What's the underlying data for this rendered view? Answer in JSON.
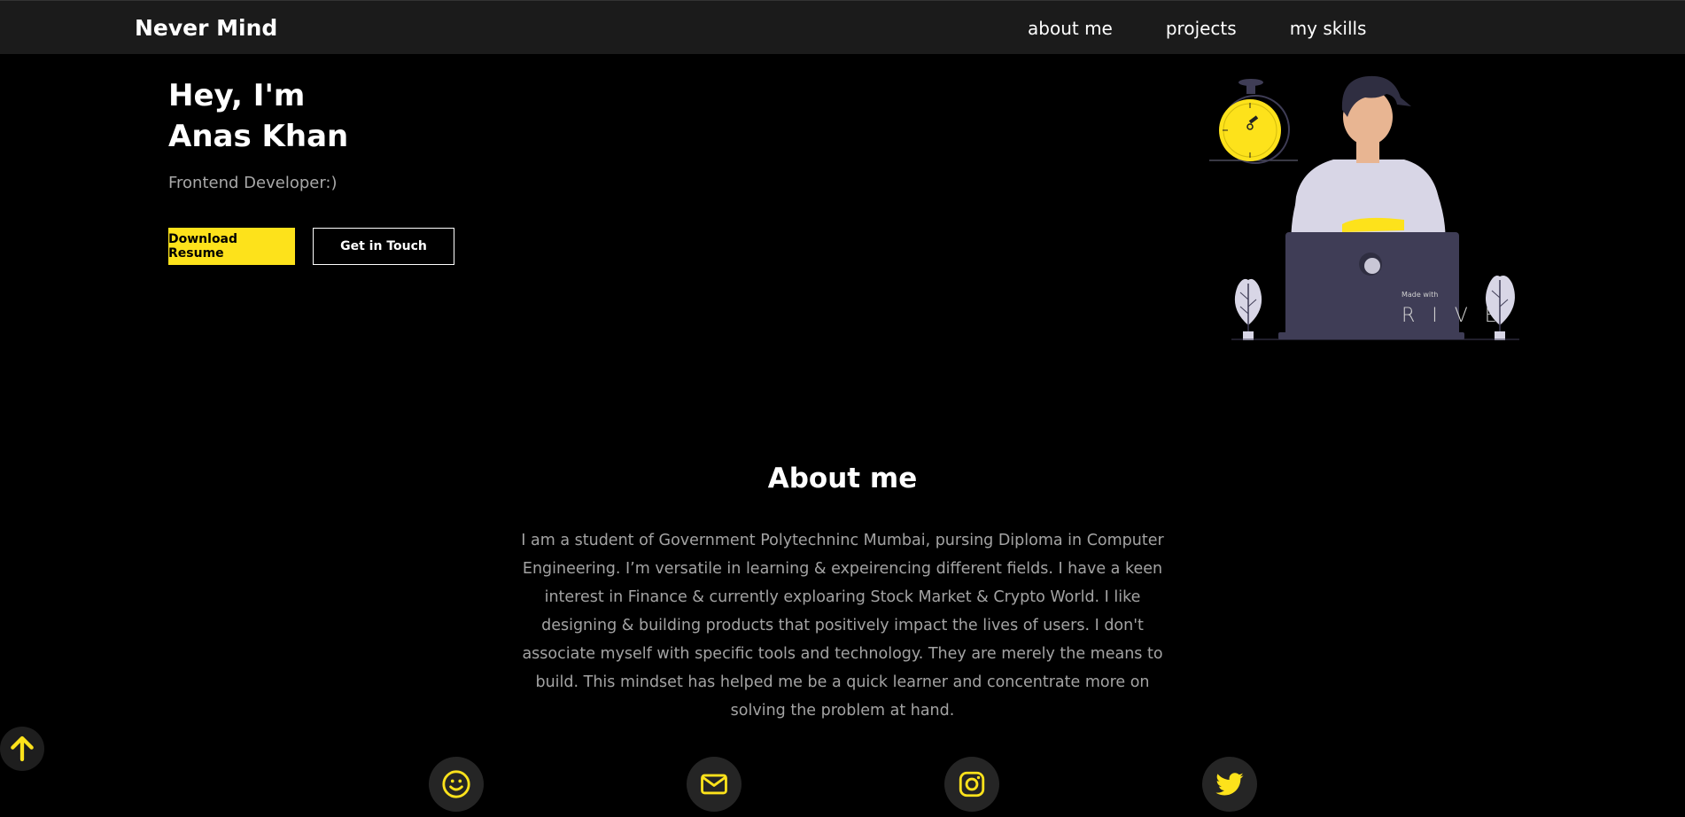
{
  "nav": {
    "brand": "Never Mind",
    "links": [
      "about me",
      "projects",
      "my skills"
    ]
  },
  "hero": {
    "greeting": "Hey, I'm",
    "name": "Anas Khan",
    "subtitle": "Frontend Developer:)",
    "download_button": "Download Resume",
    "contact_button": "Get in Touch"
  },
  "illustration": {
    "badge_small": "Made with",
    "badge_large": "R I V E"
  },
  "about": {
    "title": "About me",
    "text": "I am a student of Government Polytechninc Mumbai, pursing Diploma in Computer Engineering. I’m versatile in learning & expeirencing different fields. I have a keen interest in Finance & currently exploaring Stock Market & Crypto World. I like designing & building products that positively impact the lives of users. I don't associate myself with specific tools and technology. They are merely the means to build. This mindset has helped me be a quick learner and concentrate more on solving the problem at hand."
  },
  "social": {
    "icons": [
      "smile-icon",
      "mail-icon",
      "instagram-icon",
      "twitter-icon"
    ]
  },
  "colors": {
    "accent": "#fde21b",
    "background": "#000000",
    "nav_bg": "#1b1b1b",
    "muted_text": "#a3a3a3",
    "icon_circle": "#252525"
  }
}
